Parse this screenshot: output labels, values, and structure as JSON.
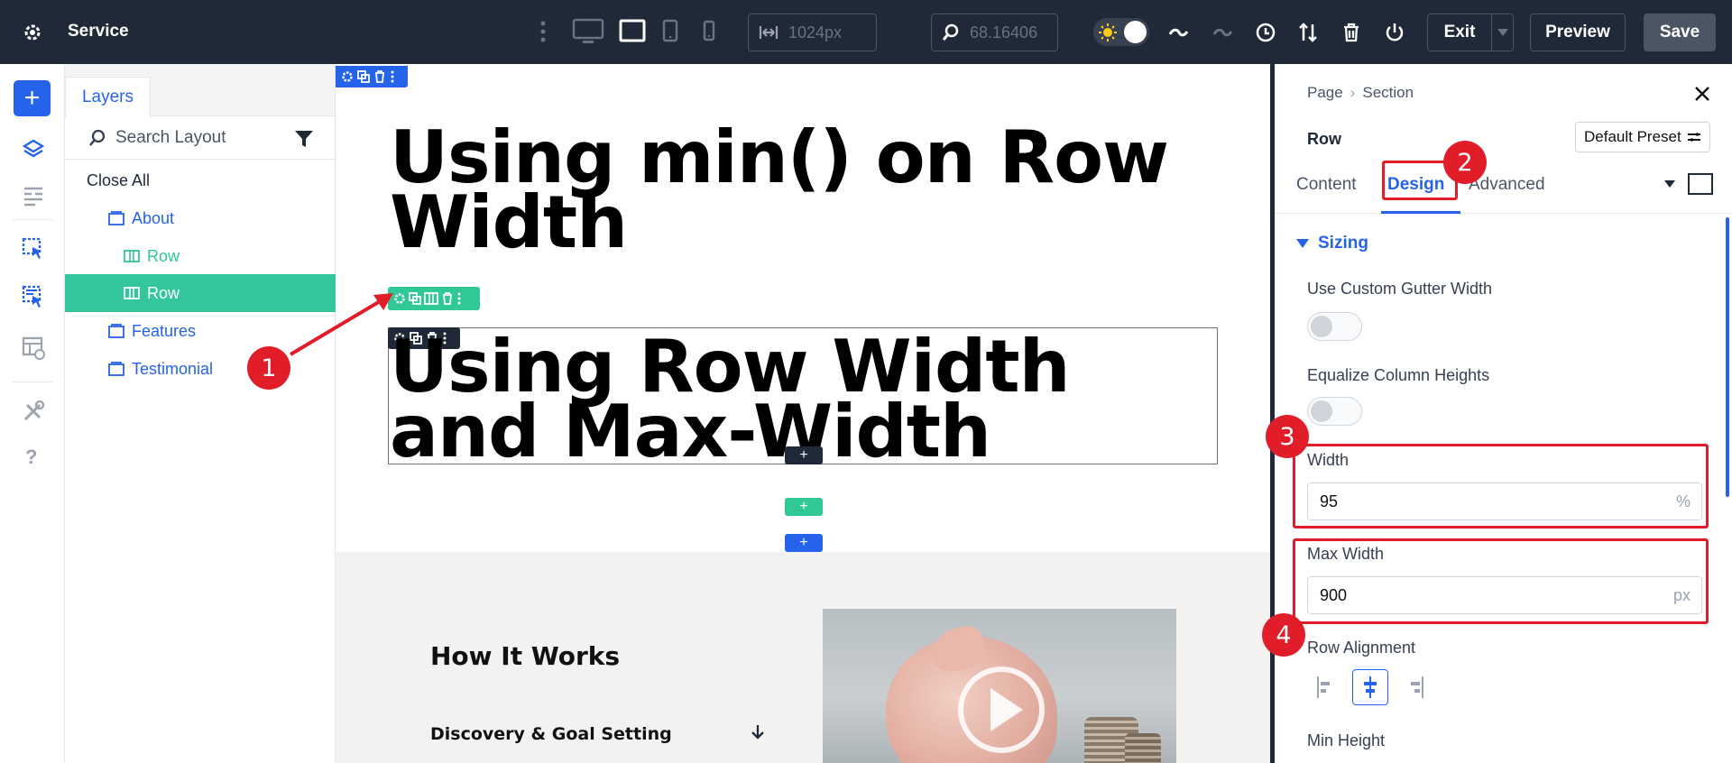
{
  "topbar": {
    "title": "Service",
    "width_value": "1024px",
    "zoom_value": "68.16406",
    "exit_label": "Exit",
    "preview_label": "Preview",
    "save_label": "Save"
  },
  "layers": {
    "tab_label": "Layers",
    "search_placeholder": "Search Layout",
    "close_all": "Close All",
    "items": [
      {
        "label": "About",
        "type": "section"
      },
      {
        "label": "Row",
        "type": "row"
      },
      {
        "label": "Row",
        "type": "row",
        "active": true
      },
      {
        "label": "Features",
        "type": "section"
      },
      {
        "label": "Testimonial",
        "type": "section"
      }
    ]
  },
  "canvas": {
    "heading1": "Using min() on Row Width",
    "heading2": "Using Row Width and Max-Width",
    "how_title": "How It Works",
    "accordion_title": "Discovery & Goal Setting"
  },
  "settings": {
    "breadcrumb": [
      "Page",
      "Section"
    ],
    "element_name": "Row",
    "preset_label": "Default Preset",
    "tabs": [
      "Content",
      "Design",
      "Advanced"
    ],
    "group_label": "Sizing",
    "gutter_label": "Use Custom Gutter Width",
    "equalize_label": "Equalize Column Heights",
    "width_label": "Width",
    "width_value": "95",
    "width_unit": "%",
    "max_width_label": "Max Width",
    "max_width_value": "900",
    "max_width_unit": "px",
    "row_alignment_label": "Row Alignment",
    "min_height_label": "Min Height"
  },
  "annotations": {
    "badge1": "1",
    "badge2": "2",
    "badge3": "3",
    "badge4": "4"
  },
  "colors": {
    "topbar": "#1f2937",
    "accent_blue": "#2563eb",
    "row_green": "#34c79e",
    "highlight_red": "#e11d2a"
  }
}
